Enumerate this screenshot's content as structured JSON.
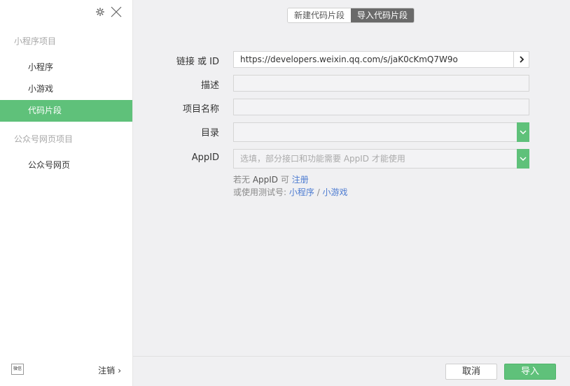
{
  "sidebar": {
    "section1_title": "小程序项目",
    "items1": [
      {
        "label": "小程序"
      },
      {
        "label": "小游戏"
      },
      {
        "label": "代码片段"
      }
    ],
    "section2_title": "公众号网页项目",
    "items2": [
      {
        "label": "公众号网页"
      }
    ],
    "logout_label": "注销",
    "avatar_text": "微信"
  },
  "tabs": [
    {
      "label": "新建代码片段"
    },
    {
      "label": "导入代码片段"
    }
  ],
  "form": {
    "link_label": "链接 或 ID",
    "link_value": "https://developers.weixin.qq.com/s/jaK0cKmQ7W9o",
    "desc_label": "描述",
    "name_label": "项目名称",
    "dir_label": "目录",
    "appid_label": "AppID",
    "appid_placeholder": "选填，部分接口和功能需要 AppID 才能使用",
    "hint1_prefix": "若无 ",
    "hint1_appid": "AppID",
    "hint1_mid": " 可 ",
    "hint1_link": "注册",
    "hint2_prefix": "或使用测试号: ",
    "hint2_link1": "小程序",
    "hint2_sep": " / ",
    "hint2_link2": "小游戏"
  },
  "footer": {
    "cancel_label": "取消",
    "import_label": "导入"
  },
  "colors": {
    "accent": "#5fc17a",
    "link": "#4c7bd1"
  }
}
